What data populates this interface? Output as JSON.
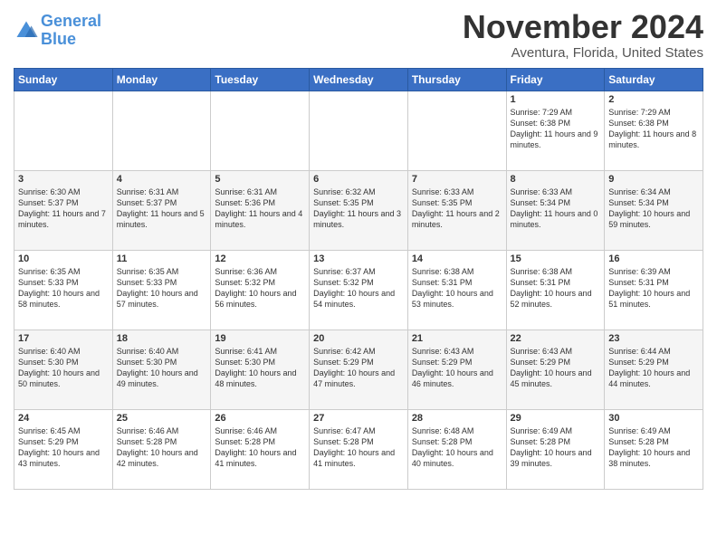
{
  "header": {
    "logo_line1": "General",
    "logo_line2": "Blue",
    "month": "November 2024",
    "location": "Aventura, Florida, United States"
  },
  "weekdays": [
    "Sunday",
    "Monday",
    "Tuesday",
    "Wednesday",
    "Thursday",
    "Friday",
    "Saturday"
  ],
  "weeks": [
    [
      {
        "day": "",
        "info": ""
      },
      {
        "day": "",
        "info": ""
      },
      {
        "day": "",
        "info": ""
      },
      {
        "day": "",
        "info": ""
      },
      {
        "day": "",
        "info": ""
      },
      {
        "day": "1",
        "info": "Sunrise: 7:29 AM\nSunset: 6:38 PM\nDaylight: 11 hours and 9 minutes."
      },
      {
        "day": "2",
        "info": "Sunrise: 7:29 AM\nSunset: 6:38 PM\nDaylight: 11 hours and 8 minutes."
      }
    ],
    [
      {
        "day": "3",
        "info": "Sunrise: 6:30 AM\nSunset: 5:37 PM\nDaylight: 11 hours and 7 minutes."
      },
      {
        "day": "4",
        "info": "Sunrise: 6:31 AM\nSunset: 5:37 PM\nDaylight: 11 hours and 5 minutes."
      },
      {
        "day": "5",
        "info": "Sunrise: 6:31 AM\nSunset: 5:36 PM\nDaylight: 11 hours and 4 minutes."
      },
      {
        "day": "6",
        "info": "Sunrise: 6:32 AM\nSunset: 5:35 PM\nDaylight: 11 hours and 3 minutes."
      },
      {
        "day": "7",
        "info": "Sunrise: 6:33 AM\nSunset: 5:35 PM\nDaylight: 11 hours and 2 minutes."
      },
      {
        "day": "8",
        "info": "Sunrise: 6:33 AM\nSunset: 5:34 PM\nDaylight: 11 hours and 0 minutes."
      },
      {
        "day": "9",
        "info": "Sunrise: 6:34 AM\nSunset: 5:34 PM\nDaylight: 10 hours and 59 minutes."
      }
    ],
    [
      {
        "day": "10",
        "info": "Sunrise: 6:35 AM\nSunset: 5:33 PM\nDaylight: 10 hours and 58 minutes."
      },
      {
        "day": "11",
        "info": "Sunrise: 6:35 AM\nSunset: 5:33 PM\nDaylight: 10 hours and 57 minutes."
      },
      {
        "day": "12",
        "info": "Sunrise: 6:36 AM\nSunset: 5:32 PM\nDaylight: 10 hours and 56 minutes."
      },
      {
        "day": "13",
        "info": "Sunrise: 6:37 AM\nSunset: 5:32 PM\nDaylight: 10 hours and 54 minutes."
      },
      {
        "day": "14",
        "info": "Sunrise: 6:38 AM\nSunset: 5:31 PM\nDaylight: 10 hours and 53 minutes."
      },
      {
        "day": "15",
        "info": "Sunrise: 6:38 AM\nSunset: 5:31 PM\nDaylight: 10 hours and 52 minutes."
      },
      {
        "day": "16",
        "info": "Sunrise: 6:39 AM\nSunset: 5:31 PM\nDaylight: 10 hours and 51 minutes."
      }
    ],
    [
      {
        "day": "17",
        "info": "Sunrise: 6:40 AM\nSunset: 5:30 PM\nDaylight: 10 hours and 50 minutes."
      },
      {
        "day": "18",
        "info": "Sunrise: 6:40 AM\nSunset: 5:30 PM\nDaylight: 10 hours and 49 minutes."
      },
      {
        "day": "19",
        "info": "Sunrise: 6:41 AM\nSunset: 5:30 PM\nDaylight: 10 hours and 48 minutes."
      },
      {
        "day": "20",
        "info": "Sunrise: 6:42 AM\nSunset: 5:29 PM\nDaylight: 10 hours and 47 minutes."
      },
      {
        "day": "21",
        "info": "Sunrise: 6:43 AM\nSunset: 5:29 PM\nDaylight: 10 hours and 46 minutes."
      },
      {
        "day": "22",
        "info": "Sunrise: 6:43 AM\nSunset: 5:29 PM\nDaylight: 10 hours and 45 minutes."
      },
      {
        "day": "23",
        "info": "Sunrise: 6:44 AM\nSunset: 5:29 PM\nDaylight: 10 hours and 44 minutes."
      }
    ],
    [
      {
        "day": "24",
        "info": "Sunrise: 6:45 AM\nSunset: 5:29 PM\nDaylight: 10 hours and 43 minutes."
      },
      {
        "day": "25",
        "info": "Sunrise: 6:46 AM\nSunset: 5:28 PM\nDaylight: 10 hours and 42 minutes."
      },
      {
        "day": "26",
        "info": "Sunrise: 6:46 AM\nSunset: 5:28 PM\nDaylight: 10 hours and 41 minutes."
      },
      {
        "day": "27",
        "info": "Sunrise: 6:47 AM\nSunset: 5:28 PM\nDaylight: 10 hours and 41 minutes."
      },
      {
        "day": "28",
        "info": "Sunrise: 6:48 AM\nSunset: 5:28 PM\nDaylight: 10 hours and 40 minutes."
      },
      {
        "day": "29",
        "info": "Sunrise: 6:49 AM\nSunset: 5:28 PM\nDaylight: 10 hours and 39 minutes."
      },
      {
        "day": "30",
        "info": "Sunrise: 6:49 AM\nSunset: 5:28 PM\nDaylight: 10 hours and 38 minutes."
      }
    ]
  ]
}
